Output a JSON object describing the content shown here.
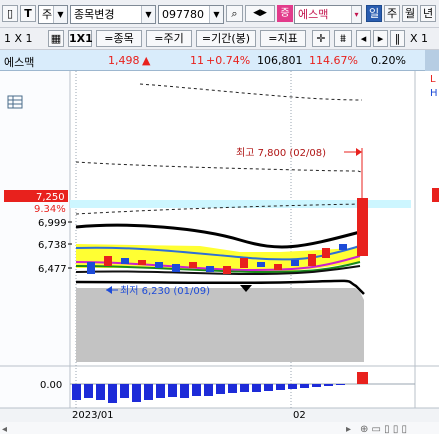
{
  "toolbar": {
    "market_label": "주",
    "search_mode": "종목변경",
    "stock_code": "097780",
    "badge": "증",
    "stock_name": "에스맥",
    "periods": [
      "일",
      "주",
      "월",
      "년"
    ],
    "active_period": "일"
  },
  "toolbar2": {
    "layout_label": "1 X 1",
    "layout2_label": "1X1",
    "btn_stock": "=종목",
    "btn_cycle": "=주기",
    "btn_range": "=기간(봉)",
    "btn_indicator": "=지표",
    "right_label": "X 1"
  },
  "info": {
    "name": "에스맥",
    "price": "1,498",
    "direction": "▲",
    "change": "11",
    "change_pct": "+0.74%",
    "volume": "106,801",
    "volume_ratio": "114.67%",
    "turnover": "0.20%"
  },
  "chart": {
    "high_annotation": "최고 7,800 (02/08)",
    "low_annotation": "최저 6,230 (01/09)",
    "current_price": "7,250",
    "current_pct": "9.34%",
    "y_ticks": [
      "6,999",
      "6,738",
      "6,477"
    ],
    "zero_label": "0.00",
    "x_labels": [
      "2023/01",
      "02"
    ],
    "right_edge_labels": [
      "L",
      "H"
    ]
  },
  "chart_data": {
    "type": "candlestick",
    "price_ticks": [
      6477,
      6738,
      6999
    ],
    "high": 7800,
    "low": 6230,
    "last": 7250,
    "oscillator_zero": 0.0
  },
  "colors": {
    "up": "#e8211d",
    "down": "#1d4bd8",
    "highlight_band": "#cdf6ff",
    "info_bg": "#d9ecfb",
    "yellow_band": "#ffff00"
  }
}
